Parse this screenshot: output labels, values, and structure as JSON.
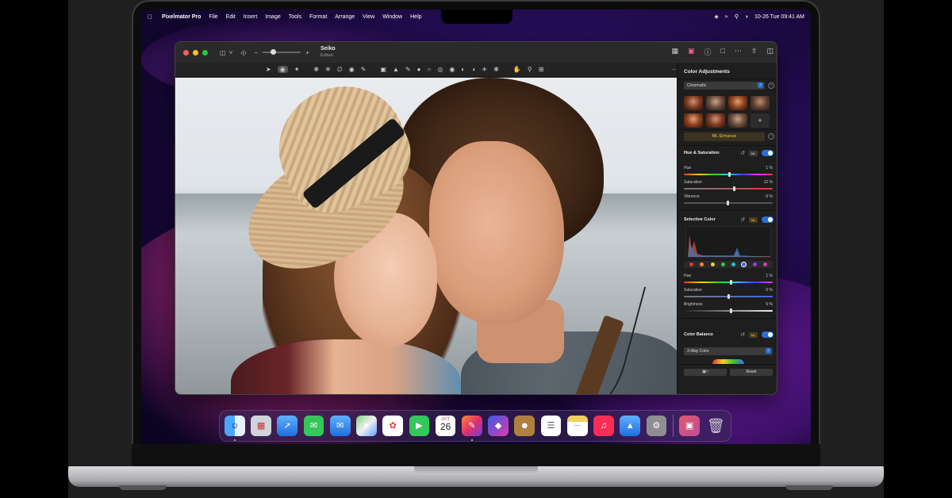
{
  "menubar": {
    "app_name": "Pixelmator Pro",
    "menus": [
      "File",
      "Edit",
      "Insert",
      "Image",
      "Tools",
      "Format",
      "Arrange",
      "View",
      "Window",
      "Help"
    ],
    "clock": "10-26 Tue  09:41 AM"
  },
  "window": {
    "doc_name": "Seiko",
    "doc_status": "Edited"
  },
  "panel": {
    "title": "Color Adjustments",
    "preset": "Cinematic",
    "ml_enhance": "ML Enhance",
    "hue_saturation": {
      "title": "Hue & Saturation",
      "hue_label": "Hue",
      "hue_value": "1 %",
      "saturation_label": "Saturation",
      "saturation_value": "12 %",
      "vibrance_label": "Vibrance",
      "vibrance_value": "-3 %"
    },
    "selective_color": {
      "title": "Selective Color",
      "hue_label": "Hue",
      "hue_value": "1 %",
      "saturation_label": "Saturation",
      "saturation_value": "0 %",
      "brightness_label": "Brightness",
      "brightness_value": "5 %"
    },
    "color_balance": {
      "title": "Color Balance",
      "mode": "3-Way Color"
    },
    "ml_badge": "ML",
    "add_label": "+",
    "reset_button": "Reset"
  },
  "dock": {
    "calendar_month": "OCT",
    "calendar_day": "26"
  },
  "colors": {
    "accent": "#2b6fd6",
    "ml_gold": "#f0c94a"
  }
}
